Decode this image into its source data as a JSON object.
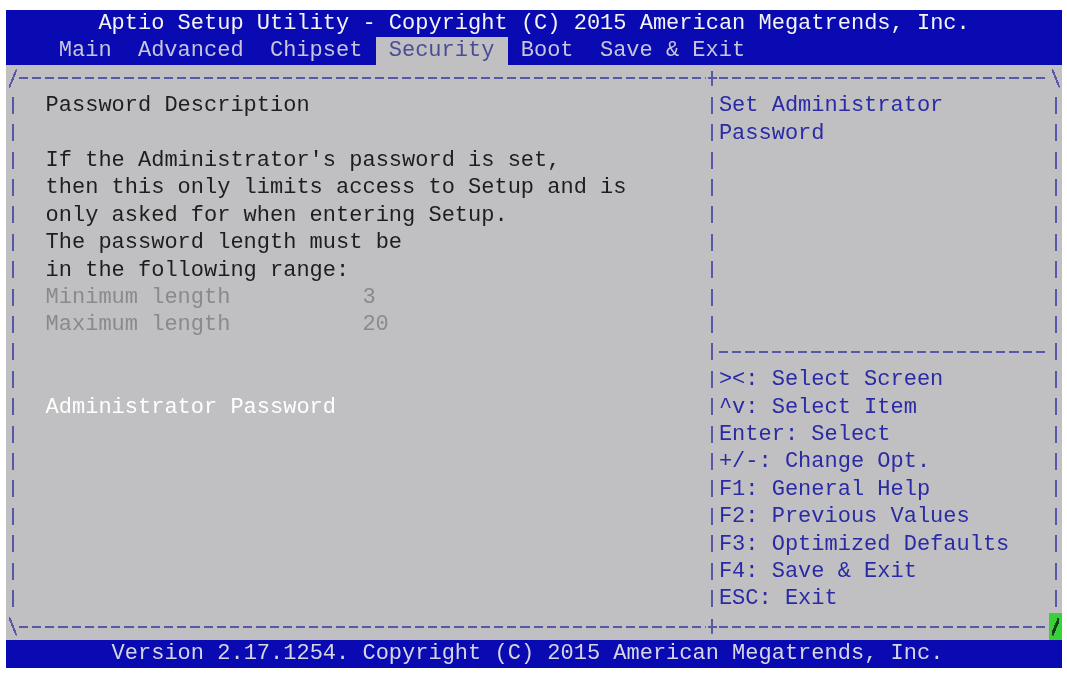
{
  "title": "Aptio Setup Utility - Copyright (C) 2015 American Megatrends, Inc.",
  "tabs": [
    {
      "label": "Main",
      "selected": false
    },
    {
      "label": "Advanced",
      "selected": false
    },
    {
      "label": "Chipset",
      "selected": false
    },
    {
      "label": "Security",
      "selected": true
    },
    {
      "label": "Boot",
      "selected": false
    },
    {
      "label": "Save & Exit",
      "selected": false
    }
  ],
  "main_panel": {
    "heading": "Password Description",
    "description": "If the Administrator's password is set,\nthen this only limits access to Setup and is\nonly asked for when entering Setup.\nThe password length must be\nin the following range:",
    "limits": [
      {
        "label": "Minimum length",
        "value": "3"
      },
      {
        "label": "Maximum length",
        "value": "20"
      }
    ],
    "items": [
      {
        "label": "Administrator Password",
        "selected": true
      }
    ]
  },
  "help_panel": {
    "help_text": "Set Administrator Password",
    "key_hints": [
      "><: Select Screen",
      "^v: Select Item",
      "Enter: Select",
      "+/-: Change Opt.",
      "F1: General Help",
      "F2: Previous Values",
      "F3: Optimized Defaults",
      "F4: Save & Exit",
      "ESC: Exit"
    ]
  },
  "footer": "Version 2.17.1254. Copyright (C) 2015 American Megatrends, Inc."
}
